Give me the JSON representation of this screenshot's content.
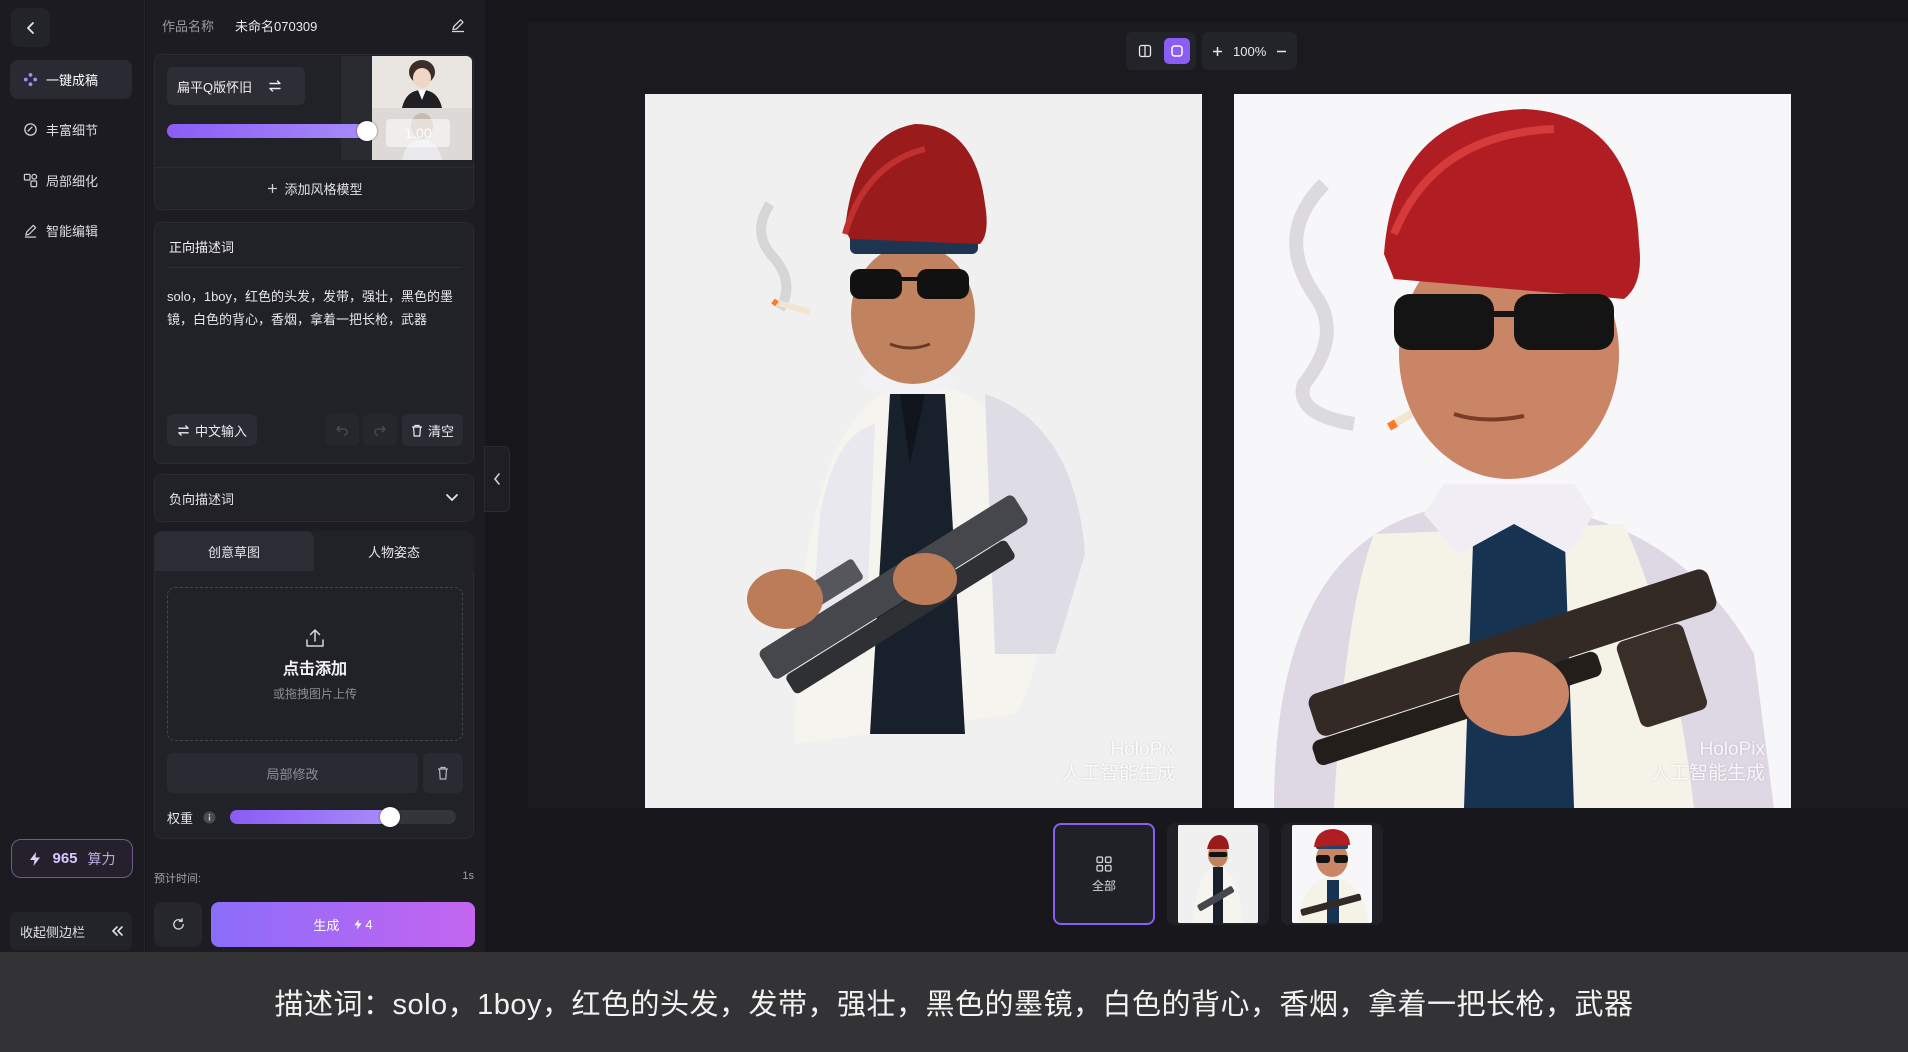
{
  "work": {
    "name_label": "作品名称",
    "name_value": "未命名070309"
  },
  "rail": {
    "items": [
      {
        "label": "一键成稿",
        "icon": "sparkle-icon"
      },
      {
        "label": "丰富细节",
        "icon": "detail-icon"
      },
      {
        "label": "局部细化",
        "icon": "local-refine-icon"
      },
      {
        "label": "智能编辑",
        "icon": "pen-icon"
      }
    ],
    "power_value": "965",
    "power_unit": "算力",
    "collapse_label": "收起侧边栏"
  },
  "style_model": {
    "name": "扁平Q版怀旧",
    "weight": "1.00",
    "weight_fraction": 0.97,
    "add_label": "添加风格模型"
  },
  "positive_prompt": {
    "title": "正向描述词",
    "text": "solo，1boy，红色的头发，发带，强壮，黑色的墨镜，白色的背心，香烟，拿着一把长枪，武器",
    "chinese_input_label": "中文输入",
    "clear_label": "清空"
  },
  "negative_prompt": {
    "title": "负向描述词"
  },
  "tabs": [
    {
      "label": "创意草图"
    },
    {
      "label": "人物姿态"
    }
  ],
  "sketch": {
    "upload_title": "点击添加",
    "upload_sub": "或拖拽图片上传",
    "local_edit_label": "局部修改",
    "weight_label": "权重",
    "weight_fraction": 0.71
  },
  "generate": {
    "est_label": "预计时间:",
    "est_value": "1s",
    "button_label": "生成",
    "cost": "4"
  },
  "toolbar": {
    "zoom": "100%"
  },
  "watermark": {
    "line1": "HoloPix",
    "line2": "人工智能生成"
  },
  "gallery": {
    "all_label": "全部"
  },
  "caption": "描述词：solo，1boy，红色的头发，发带，强壮，黑色的墨镜，白色的背心，香烟，拿着一把长枪，武器",
  "colors": {
    "accent": "#8b5cf6",
    "generate_gradient_start": "#8b6dfa",
    "generate_gradient_end": "#c465f0",
    "bg": "#16161b"
  }
}
